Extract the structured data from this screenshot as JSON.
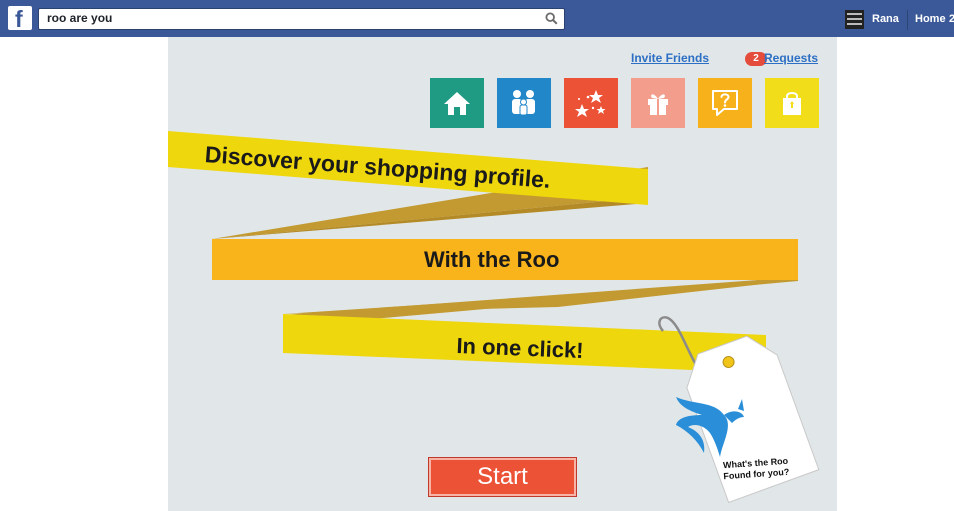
{
  "header": {
    "logo_letter": "f",
    "search_value": "roo are you",
    "search_icon": "search-icon",
    "user_name": "Rana",
    "home_label": "Home",
    "home_overflow": "2"
  },
  "app": {
    "invite_friends": "Invite Friends",
    "requests_count": "2",
    "requests_label": "Requests",
    "tiles": [
      {
        "icon": "home-icon",
        "color": "#1f9b84"
      },
      {
        "icon": "family-icon",
        "color": "#2287c9"
      },
      {
        "icon": "stars-icon",
        "color": "#ec5236"
      },
      {
        "icon": "gift-icon",
        "color": "#f39d8d"
      },
      {
        "icon": "help-bubble-icon",
        "color": "#f7b21b"
      },
      {
        "icon": "shopping-bag-icon",
        "color": "#f2dd1a"
      }
    ],
    "banner_1": "Discover your shopping profile.",
    "banner_2": "With the Roo",
    "banner_3": "In one click!",
    "start_label": "Start",
    "tag_text": "What's the Roo Found for you?"
  },
  "colors": {
    "topbar": "#3b5998",
    "canvas": "#e1e7e8",
    "ribbon_yellow": "#eed70c",
    "ribbon_orange": "#f8b41a",
    "ribbon_fold": "#c39a31",
    "start": "#ec5236",
    "link": "#2c6fc4"
  }
}
